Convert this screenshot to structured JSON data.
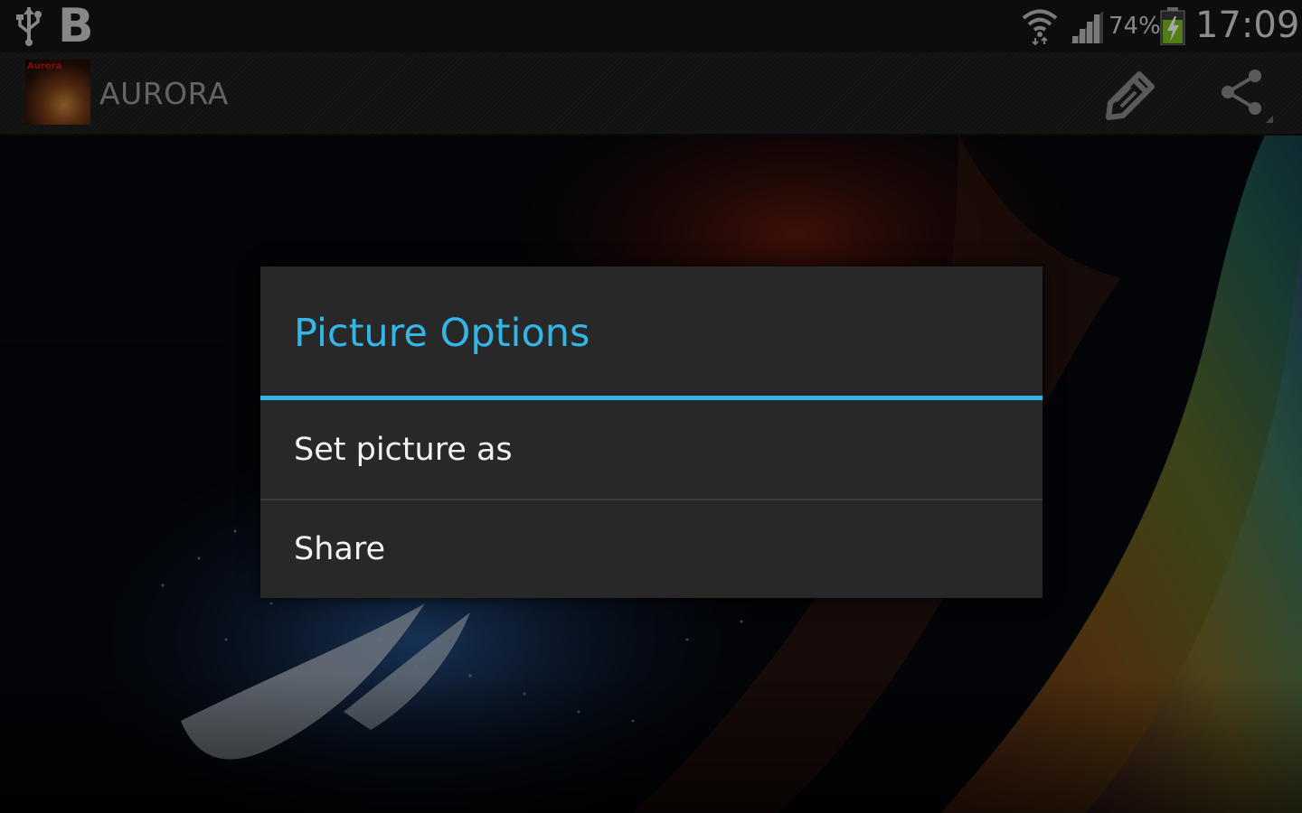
{
  "status_bar": {
    "battery_percent": "74%",
    "time": "17:09",
    "notification_b": "B",
    "icons": [
      "usb-icon",
      "b-notification-icon",
      "wifi-icon",
      "signal-icon",
      "battery-charging-icon"
    ]
  },
  "action_bar": {
    "app_icon_label": "Aurora",
    "title": "AURORA",
    "actions": [
      "edit-icon",
      "share-icon"
    ]
  },
  "dialog": {
    "title": "Picture Options",
    "items": [
      {
        "label": "Set picture as"
      },
      {
        "label": "Share"
      }
    ]
  },
  "colors": {
    "accent": "#33b5e5",
    "dialog_background": "#282828",
    "status_bar_background": "#141414",
    "action_bar_background": "#1c1c1c"
  }
}
